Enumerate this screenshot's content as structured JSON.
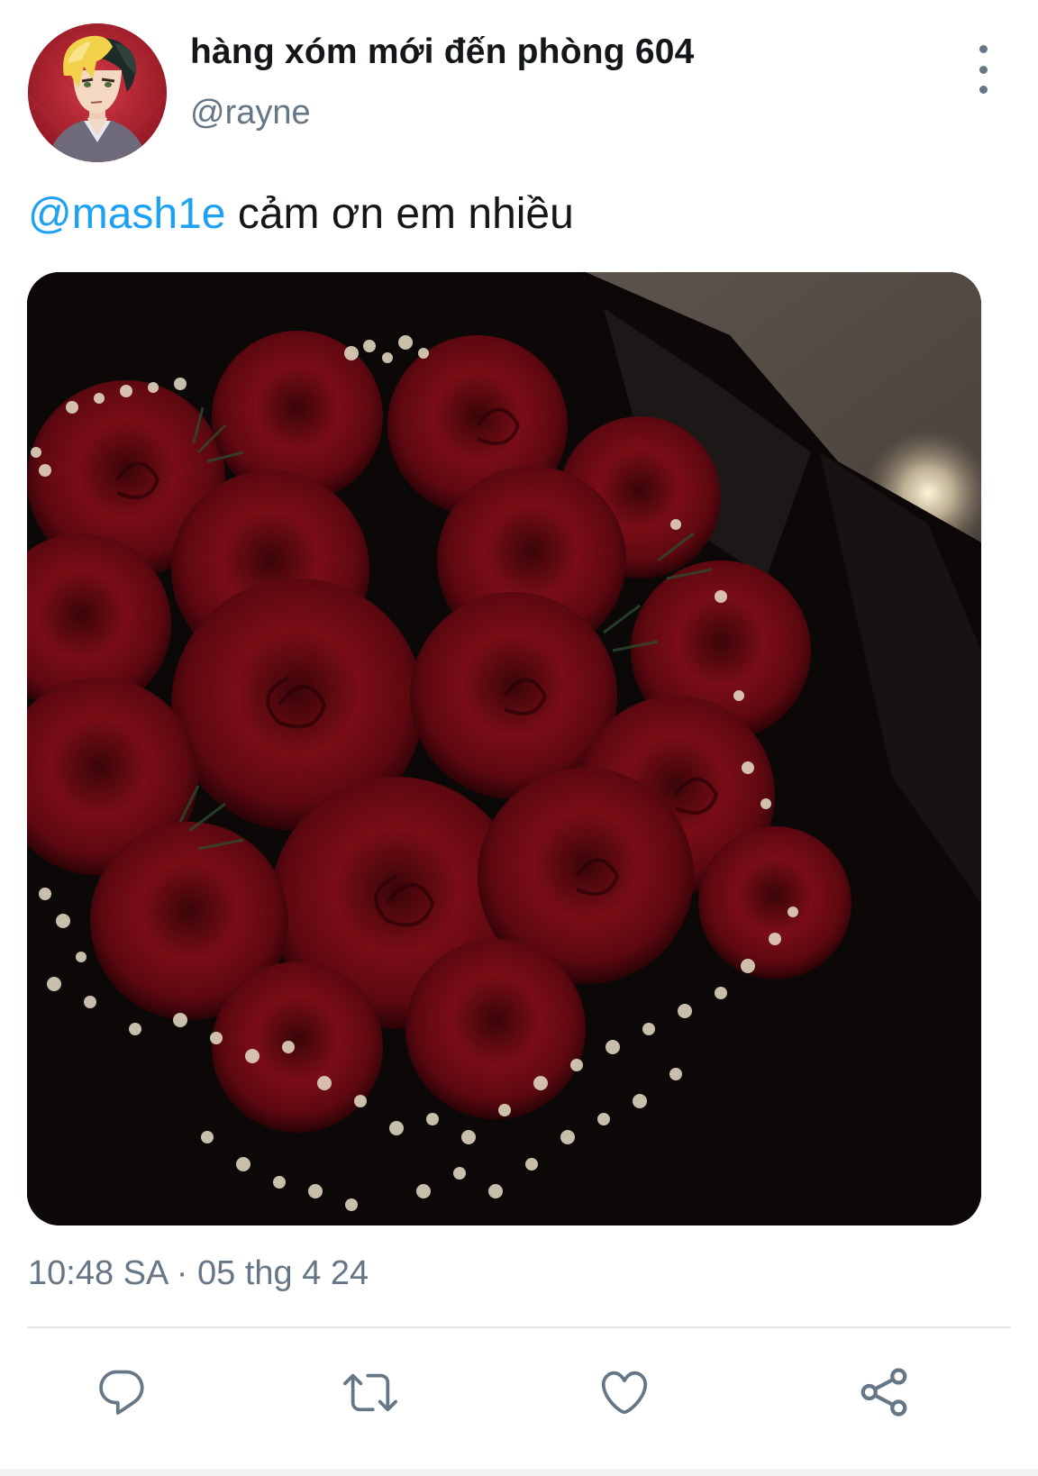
{
  "tweet": {
    "author": {
      "display_name": "hàng xóm mới đến phòng 604",
      "handle": "@rayne"
    },
    "text": {
      "mention": "@mash1e",
      "body": " cảm ơn em nhiều"
    },
    "timestamp": "10:48 SA · 05 thg 4 24"
  },
  "icons": {
    "more": "more-vertical-icon",
    "reply": "reply-icon",
    "retweet": "retweet-icon",
    "like": "heart-icon",
    "share": "share-icon"
  },
  "colors": {
    "accent": "#1da1f2",
    "secondary_text": "#657786",
    "primary_text": "#14171a",
    "divider": "#e1e8ed"
  }
}
